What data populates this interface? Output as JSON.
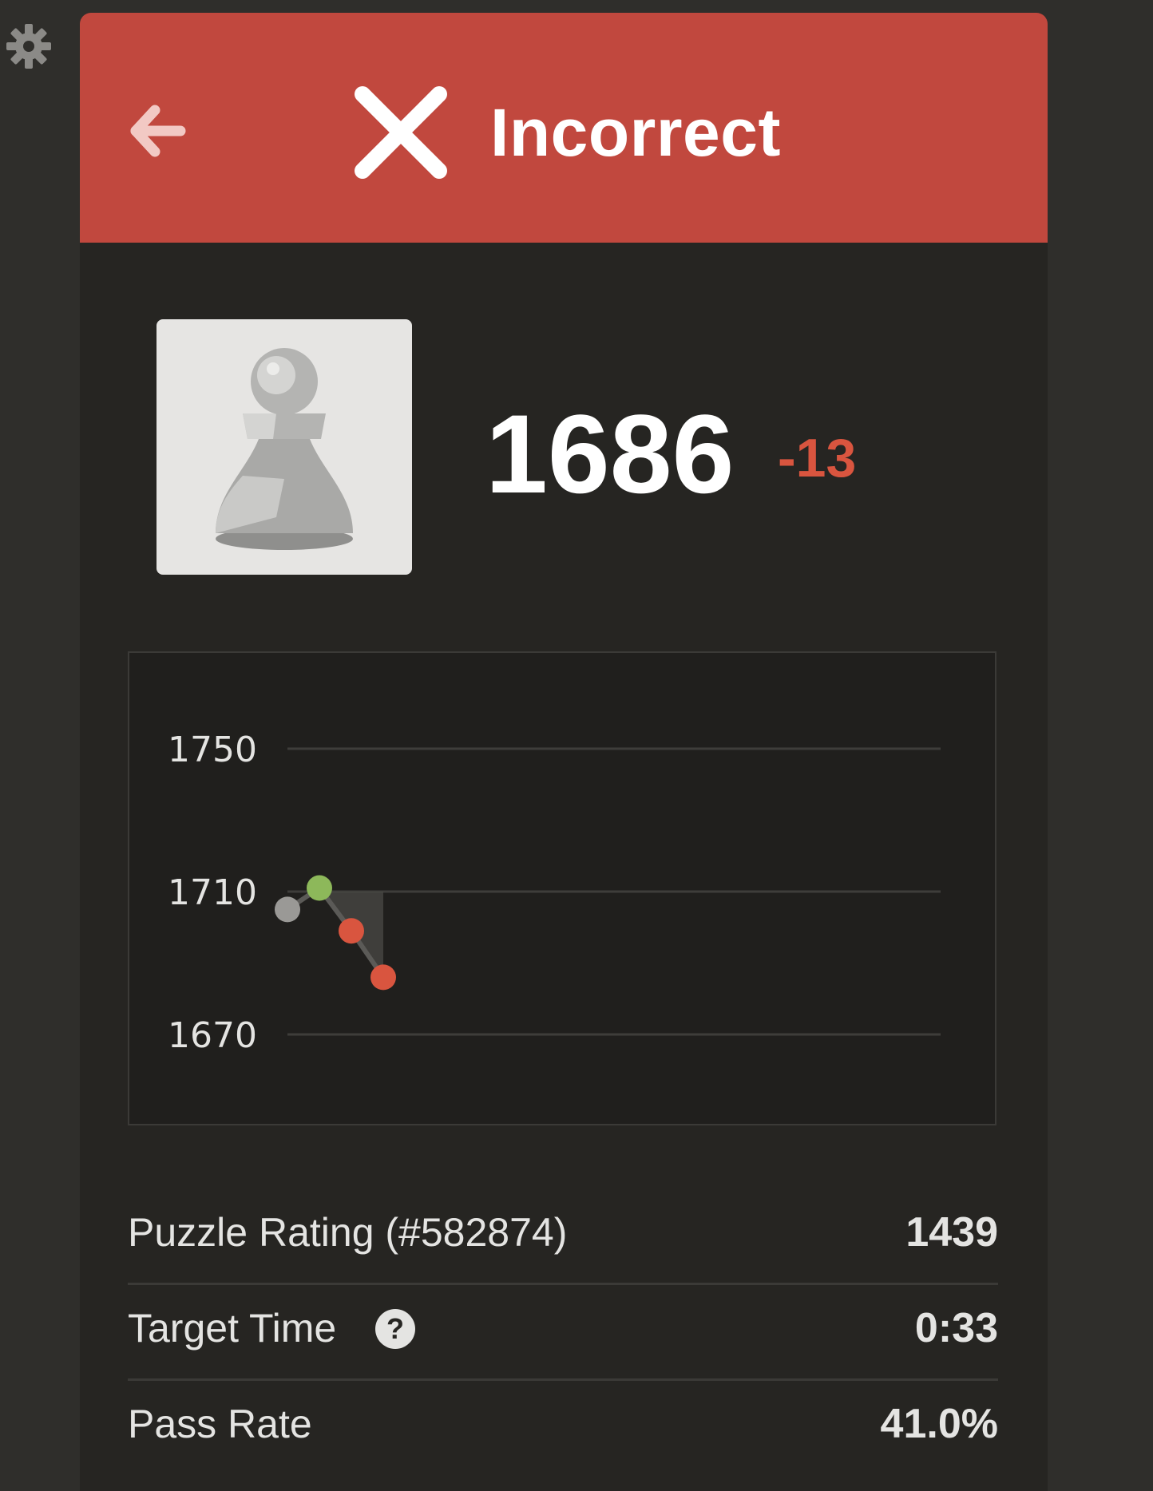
{
  "header": {
    "title": "Incorrect",
    "back_icon": "arrow-left-icon",
    "status_icon": "x-icon",
    "background_color": "#c1483e"
  },
  "settings": {
    "icon": "gear-icon"
  },
  "player": {
    "avatar_icon": "pawn-icon",
    "rating": "1686",
    "rating_change": "-13",
    "rating_change_color": "#d9553f"
  },
  "chart_data": {
    "type": "line",
    "y_ticks": [
      "1750",
      "1710",
      "1670"
    ],
    "ylim": [
      1670,
      1750
    ],
    "grid": true,
    "points": [
      {
        "index": 0,
        "rating": 1705,
        "status": "start",
        "color": "#9a9996"
      },
      {
        "index": 1,
        "rating": 1711,
        "status": "correct",
        "color": "#8db85a"
      },
      {
        "index": 2,
        "rating": 1699,
        "status": "incorrect",
        "color": "#d9553f"
      },
      {
        "index": 3,
        "rating": 1686,
        "status": "incorrect",
        "color": "#d9553f"
      }
    ],
    "xlabel": "",
    "ylabel": ""
  },
  "stats": [
    {
      "label": "Puzzle Rating (#582874)",
      "value": "1439",
      "has_help": false
    },
    {
      "label": "Target Time",
      "value": "0:33",
      "has_help": true,
      "help_icon": "question-circle-icon",
      "help_glyph": "?"
    },
    {
      "label": "Pass Rate",
      "value": "41.0%",
      "has_help": false
    }
  ]
}
